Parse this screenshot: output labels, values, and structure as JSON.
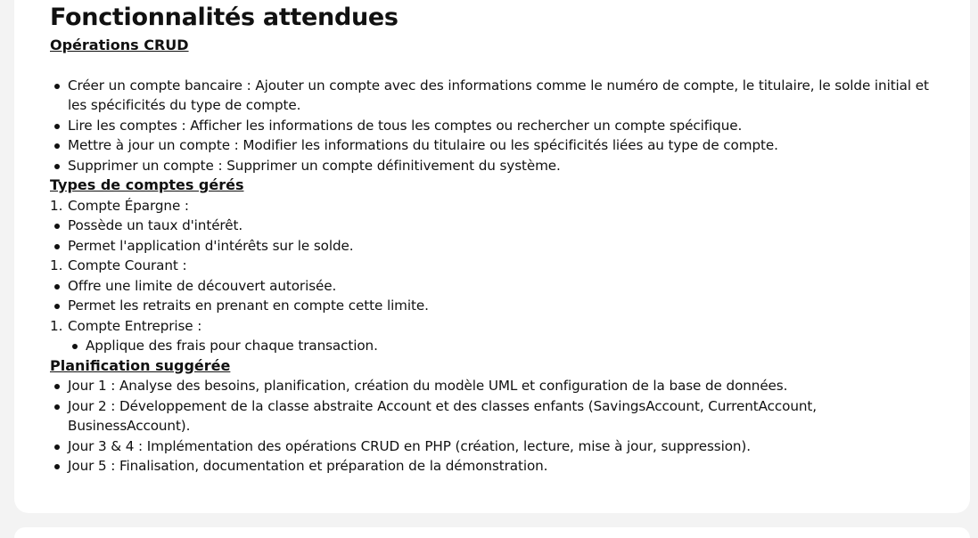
{
  "title": "Fonctionnalités attendues",
  "sections": {
    "crud": {
      "heading": "Opérations CRUD",
      "items": [
        "Créer un compte bancaire : Ajouter un compte avec des informations comme le numéro de compte, le titulaire, le solde initial et les spécificités du type de compte.",
        "Lire les comptes : Afficher les informations de tous les comptes ou rechercher un compte spécifique.",
        "Mettre à jour un compte : Modifier les informations du titulaire ou les spécificités liées au type de compte.",
        "Supprimer un compte : Supprimer un compte définitivement du système."
      ]
    },
    "types": {
      "heading": "Types de comptes gérés",
      "epargne": {
        "number": "1.",
        "label": "Compte Épargne :",
        "items": [
          "Possède un taux d'intérêt.",
          "Permet l'application d'intérêts sur le solde."
        ]
      },
      "courant": {
        "number": "1.",
        "label": "Compte Courant :",
        "items": [
          "Offre une limite de découvert autorisée.",
          "Permet les retraits en prenant en compte cette limite."
        ]
      },
      "entreprise": {
        "number": "1.",
        "label": "Compte Entreprise :",
        "items": [
          "Applique des frais pour chaque transaction."
        ]
      }
    },
    "plan": {
      "heading": "Planification suggérée",
      "items": [
        "Jour 1 : Analyse des besoins, planification, création du modèle UML et configuration de la base de données.",
        "Jour 2 : Développement de la classe abstraite Account et des classes enfants (SavingsAccount, CurrentAccount, BusinessAccount).",
        "Jour 3 & 4 : Implémentation des opérations CRUD en PHP (création, lecture, mise à jour, suppression).",
        "Jour 5 : Finalisation, documentation et préparation de la démonstration."
      ]
    }
  }
}
